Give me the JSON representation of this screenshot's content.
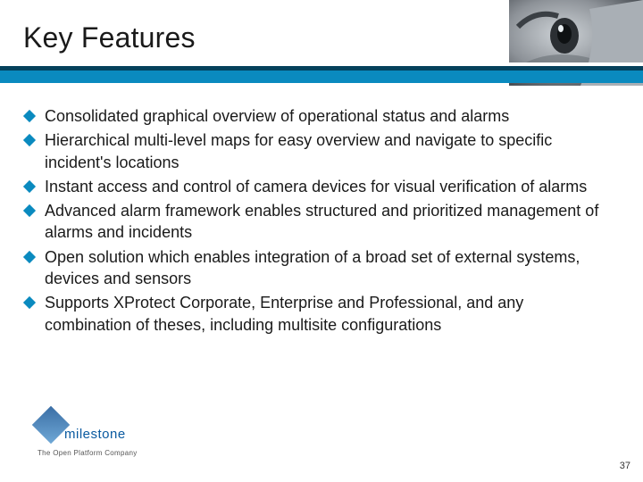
{
  "title": "Key Features",
  "bullets": [
    "Consolidated graphical overview of operational status and alarms",
    "Hierarchical multi-level maps for easy overview and navigate to specific incident's locations",
    "Instant access and control of camera devices for visual verification of alarms",
    "Advanced alarm framework enables structured and prioritized management of alarms and incidents",
    "Open solution which enables integration of a broad set of external systems, devices and sensors",
    "Supports XProtect Corporate, Enterprise and Professional, and any combination of theses, including multisite configurations"
  ],
  "logo": {
    "name": "milestone",
    "tagline": "The Open Platform Company"
  },
  "page_number": "37"
}
